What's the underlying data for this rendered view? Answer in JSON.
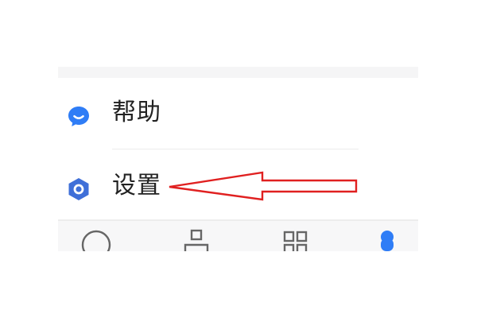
{
  "menu": {
    "items": [
      {
        "label": "帮助",
        "icon": "chat-bubble-icon",
        "icon_color": "#2f7df6"
      },
      {
        "label": "设置",
        "icon": "hexagon-settings-icon",
        "icon_color": "#3f6fd8"
      }
    ]
  },
  "tabbar": {
    "tabs": [
      {
        "icon": "chat-circle-icon"
      },
      {
        "icon": "contacts-icon"
      },
      {
        "icon": "grid-apps-icon"
      },
      {
        "icon": "profile-icon",
        "active_color": "#2f7df6"
      }
    ]
  },
  "annotation": {
    "arrow_color": "#e02020",
    "points_to": "设置"
  }
}
